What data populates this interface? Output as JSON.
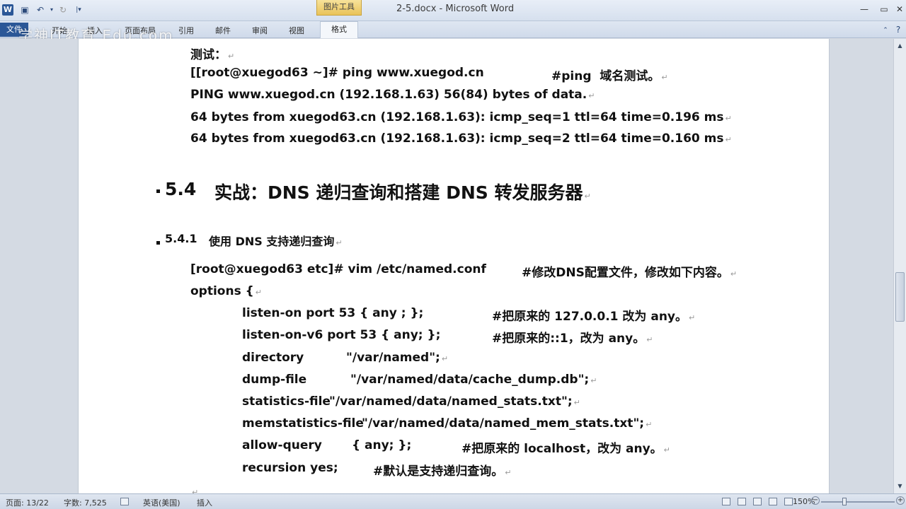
{
  "titlebar": {
    "app_icon": "W",
    "window_title": "2-5.docx - Microsoft Word",
    "contextual_tab_group": "图片工具",
    "quick_access": [
      "save-icon",
      "undo-icon",
      "redo-icon",
      "customize-icon"
    ]
  },
  "ribbon": {
    "file_tab": "文件",
    "tabs": [
      "开始",
      "插入",
      "页面布局",
      "引用",
      "邮件",
      "审阅",
      "视图"
    ],
    "format_tab": "格式"
  },
  "watermark": "学神IT教育 Edu.com",
  "document": {
    "lines": [
      "测试：",
      "[[root@xuegod63 ~]# ping www.xuegod.cn",
      "#ping  域名测试。",
      "PING www.xuegod.cn (192.168.1.63) 56(84) bytes of data.",
      "64 bytes from xuegod63.cn (192.168.1.63): icmp_seq=1 ttl=64 time=0.196 ms",
      "64 bytes from xuegod63.cn (192.168.1.63): icmp_seq=2 ttl=64 time=0.160 ms"
    ],
    "heading2_number": "5.4",
    "heading2_text": "实战：DNS 递归查询和搭建 DNS 转发服务器",
    "heading3_number": "5.4.1",
    "heading3_text": "使用 DNS 支持递归查询",
    "vim_cmd": "[root@xuegod63 etc]# vim /etc/named.conf",
    "vim_comment": "#修改DNS配置文件，修改如下内容。",
    "options_open": "options {",
    "config": [
      {
        "key": "listen-on port 53 { any ; };",
        "value": "",
        "comment": "#把原来的 127.0.0.1 改为 any。"
      },
      {
        "key": "listen-on-v6 port 53 { any; };",
        "value": "",
        "comment": "#把原来的::1，改为 any。"
      },
      {
        "key": "directory",
        "value": "\"/var/named\";",
        "comment": ""
      },
      {
        "key": "dump-file",
        "value": "\"/var/named/data/cache_dump.db\";",
        "comment": ""
      },
      {
        "key": "statistics-file",
        "value": "\"/var/named/data/named_stats.txt\";",
        "comment": ""
      },
      {
        "key": "memstatistics-file",
        "value": "\"/var/named/data/named_mem_stats.txt\";",
        "comment": ""
      },
      {
        "key": "allow-query",
        "value": "{ any; };",
        "comment": "#把原来的 localhost，改为 any。"
      },
      {
        "key": "recursion yes;",
        "value": "",
        "comment": "#默认是支持递归查询。"
      }
    ],
    "paragraph_mark": "↵"
  },
  "statusbar": {
    "page": "页面: 13/22",
    "words": "字数: 7,525",
    "language": "英语(美国)",
    "mode": "插入",
    "zoom": "150%"
  }
}
